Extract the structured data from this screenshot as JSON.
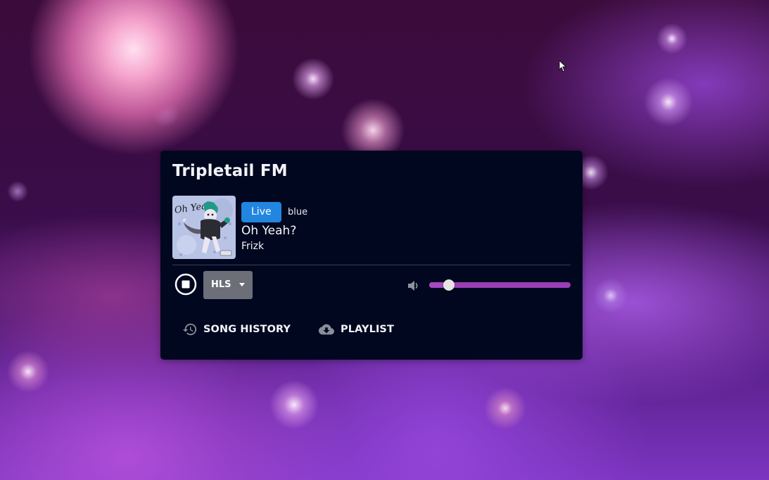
{
  "player": {
    "station_name": "Tripletail FM",
    "now_playing": {
      "live_badge": "Live",
      "streamer": "blue",
      "title": "Oh Yeah?",
      "artist": "Frizk",
      "album_art_text": "Oh Yeah"
    },
    "controls": {
      "stop_icon": "stop-circle-icon",
      "stream_format": "HLS",
      "volume_icon": "speaker-low-icon",
      "volume_level": 0.14
    },
    "links": {
      "song_history": "SONG HISTORY",
      "song_history_icon": "history-icon",
      "playlist": "PLAYLIST",
      "playlist_icon": "cloud-download-icon"
    }
  },
  "colors": {
    "card_background": "#00071f",
    "live_badge": "#2286e0",
    "volume_track": "#9a3fb6",
    "format_button": "#6c6f78"
  }
}
